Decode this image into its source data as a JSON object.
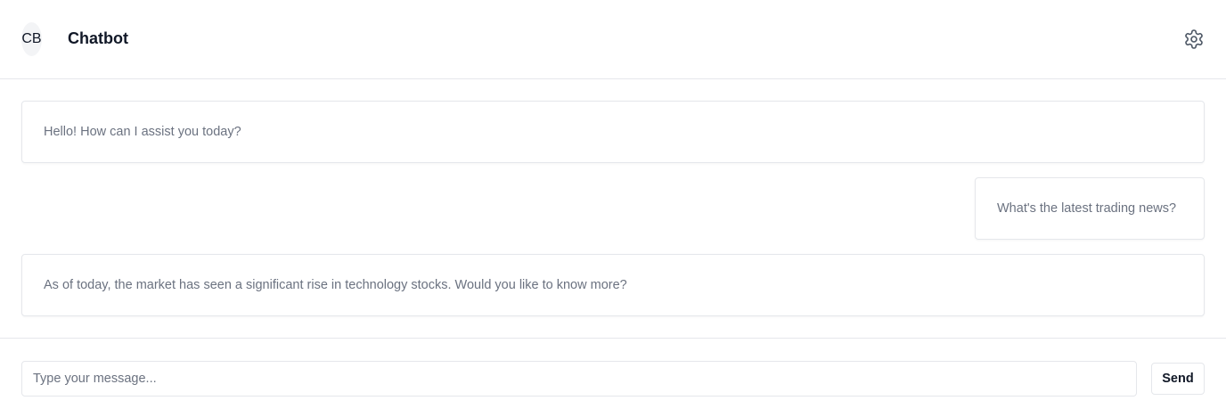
{
  "header": {
    "avatar_initials": "CB",
    "title": "Chatbot",
    "settings_icon": "gear-icon"
  },
  "messages": [
    {
      "role": "bot",
      "text": "Hello! How can I assist you today?"
    },
    {
      "role": "user",
      "text": "What's the latest trading news?"
    },
    {
      "role": "bot",
      "text": "As of today, the market has seen a significant rise in technology stocks. Would you like to know more?"
    }
  ],
  "composer": {
    "value": "",
    "placeholder": "Type your message...",
    "send_label": "Send"
  },
  "colors": {
    "border": "#e5e7eb",
    "muted_text": "#6b7280",
    "primary_text": "#111827",
    "avatar_bg": "#f3f4f6"
  }
}
